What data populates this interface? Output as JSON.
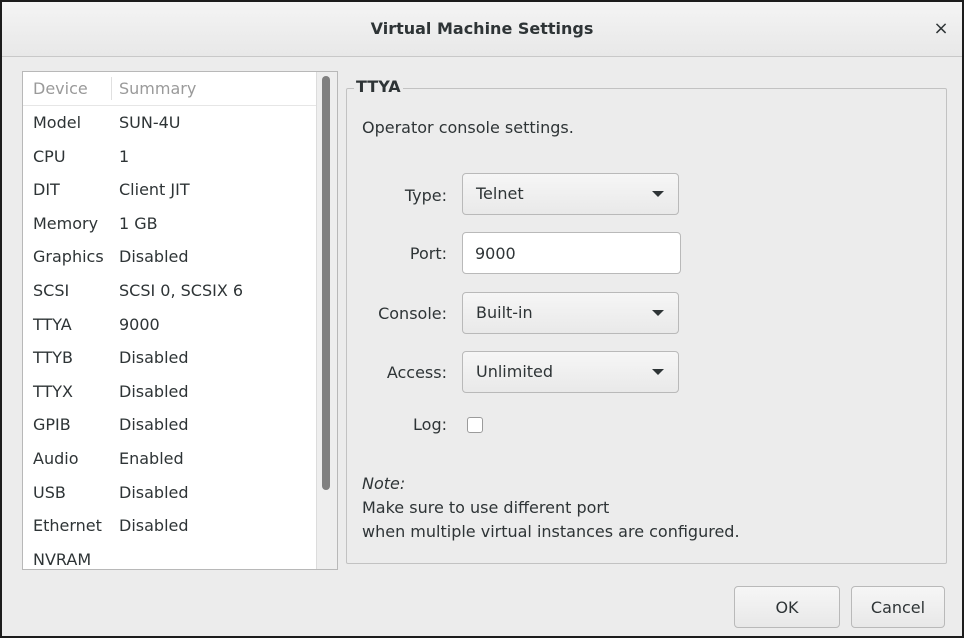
{
  "window": {
    "title": "Virtual Machine Settings",
    "close_glyph": "×"
  },
  "device_list": {
    "headers": {
      "device": "Device",
      "summary": "Summary"
    },
    "rows": [
      {
        "device": "Model",
        "summary": "SUN-4U"
      },
      {
        "device": "CPU",
        "summary": "1"
      },
      {
        "device": "DIT",
        "summary": "Client JIT"
      },
      {
        "device": "Memory",
        "summary": "1 GB"
      },
      {
        "device": "Graphics",
        "summary": "Disabled"
      },
      {
        "device": "SCSI",
        "summary": "SCSI 0, SCSIX 6"
      },
      {
        "device": "TTYA",
        "summary": "9000"
      },
      {
        "device": "TTYB",
        "summary": "Disabled"
      },
      {
        "device": "TTYX",
        "summary": "Disabled"
      },
      {
        "device": "GPIB",
        "summary": "Disabled"
      },
      {
        "device": "Audio",
        "summary": "Enabled"
      },
      {
        "device": "USB",
        "summary": "Disabled"
      },
      {
        "device": "Ethernet",
        "summary": "Disabled"
      },
      {
        "device": "NVRAM",
        "summary": ""
      }
    ]
  },
  "ttya": {
    "legend": "TTYA",
    "description": "Operator console settings.",
    "type": {
      "label": "Type:",
      "value": "Telnet"
    },
    "port": {
      "label": "Port:",
      "value": "9000"
    },
    "console": {
      "label": "Console:",
      "value": "Built-in"
    },
    "access": {
      "label": "Access:",
      "value": "Unlimited"
    },
    "log": {
      "label": "Log:",
      "checked": false
    },
    "note": {
      "title": "Note:",
      "line1": "Make sure to use different port",
      "line2": "when multiple virtual instances are configured."
    }
  },
  "buttons": {
    "ok": "OK",
    "cancel": "Cancel"
  }
}
